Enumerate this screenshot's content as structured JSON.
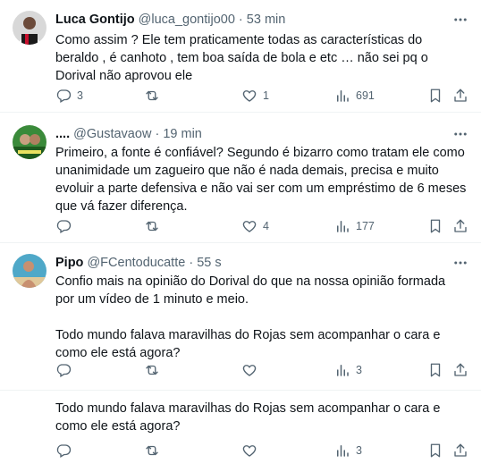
{
  "tweets": [
    {
      "name": "Luca Gontijo",
      "handle": "@luca_gontijo00",
      "time": "53 min",
      "text": [
        "Como assim ? Ele tem praticamente todas as características do beraldo , é canhoto , tem boa saída de bola e etc … não sei pq o Dorival não aprovou ele"
      ],
      "replies": "3",
      "retweets": "",
      "likes": "1",
      "views": "691"
    },
    {
      "name": "....",
      "handle": "@Gustavaow",
      "time": "19 min",
      "text": [
        "Primeiro, a fonte é confiável? Segundo é bizarro como tratam ele como unanimidade um zagueiro que não é nada demais, precisa e muito evoluir a parte defensiva e não vai ser com um empréstimo de 6 meses que vá fazer diferença."
      ],
      "replies": "",
      "retweets": "",
      "likes": "4",
      "views": "177"
    },
    {
      "name": "Pipo",
      "handle": "@FCentoducatte",
      "time": "55 s",
      "text": [
        "Confio mais na opinião do Dorival do que na nossa opinião formada por um vídeo de 1 minuto e meio.",
        "Todo mundo falava maravilhas do Rojas sem acompanhar o cara e como ele está agora?"
      ],
      "replies": "",
      "retweets": "",
      "likes": "",
      "views": "3"
    },
    {
      "text": [
        "Todo mundo falava maravilhas do Rojas sem acompanhar o cara e como ele está agora?"
      ],
      "replies": "",
      "retweets": "",
      "likes": "",
      "views": "3"
    }
  ],
  "separator": "·",
  "icons": {
    "reply": "reply-icon",
    "retweet": "retweet-icon",
    "like": "heart-icon",
    "views": "views-icon",
    "bookmark": "bookmark-icon",
    "share": "share-icon",
    "more": "more-icon"
  },
  "colors": {
    "text": "#0f1419",
    "secondary": "#536471",
    "border": "#eff3f4"
  }
}
